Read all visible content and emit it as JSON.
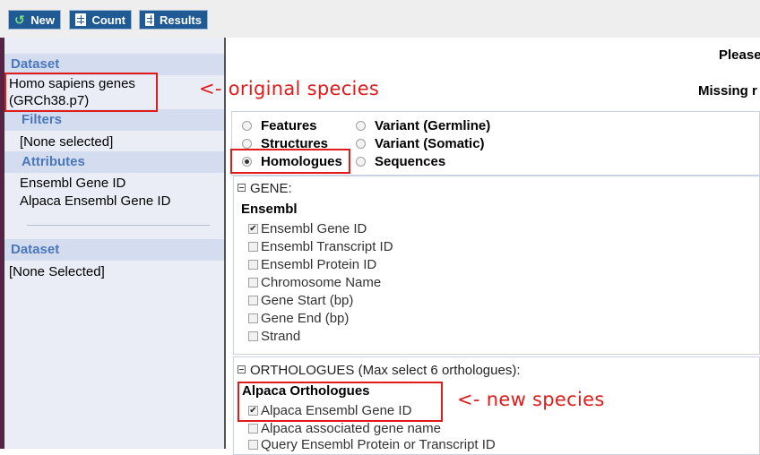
{
  "toolbar": {
    "new_label": "New",
    "count_label": "Count",
    "results_label": "Results"
  },
  "left_panel": {
    "dataset1_head": "Dataset",
    "dataset1_line1": "Homo sapiens genes",
    "dataset1_line2": "(GRCh38.p7)",
    "filters_head": "Filters",
    "filters_value": "[None selected]",
    "attributes_head": "Attributes",
    "attributes": [
      "Ensembl Gene ID",
      "Alpaca Ensembl Gene ID"
    ],
    "dataset2_head": "Dataset",
    "dataset2_value": "[None Selected]"
  },
  "right_panel": {
    "please_text": "Please",
    "missing_text": "Missing r",
    "radios": [
      {
        "label": "Features",
        "selected": false
      },
      {
        "label": "Structures",
        "selected": false
      },
      {
        "label": "Homologues",
        "selected": true
      },
      {
        "label": "Variant (Germline)",
        "selected": false
      },
      {
        "label": "Variant (Somatic)",
        "selected": false
      },
      {
        "label": "Sequences",
        "selected": false
      }
    ],
    "gene_header": "GENE:",
    "ensembl_label": "Ensembl",
    "gene_fields": [
      {
        "label": "Ensembl Gene ID",
        "checked": true
      },
      {
        "label": "Ensembl Transcript ID",
        "checked": false
      },
      {
        "label": "Ensembl Protein ID",
        "checked": false
      },
      {
        "label": "Chromosome Name",
        "checked": false
      },
      {
        "label": "Gene Start (bp)",
        "checked": false
      },
      {
        "label": "Gene End (bp)",
        "checked": false
      },
      {
        "label": "Strand",
        "checked": false
      }
    ],
    "orthologues_header": "ORTHOLOGUES (Max select 6 orthologues):",
    "alpaca_label": "Alpaca Orthologues",
    "alpaca_fields": [
      {
        "label": "Alpaca Ensembl Gene ID",
        "checked": true
      },
      {
        "label": "Alpaca associated gene name",
        "checked": false
      },
      {
        "label": "Query Ensembl Protein or Transcript ID",
        "checked": false
      }
    ]
  },
  "annotations": {
    "original": "<- original species",
    "new": "<- new species"
  },
  "colors": {
    "toolbar_button": "#1f5a94",
    "section_header_text": "#4a78bb",
    "annotation_red": "#e11a1a"
  }
}
